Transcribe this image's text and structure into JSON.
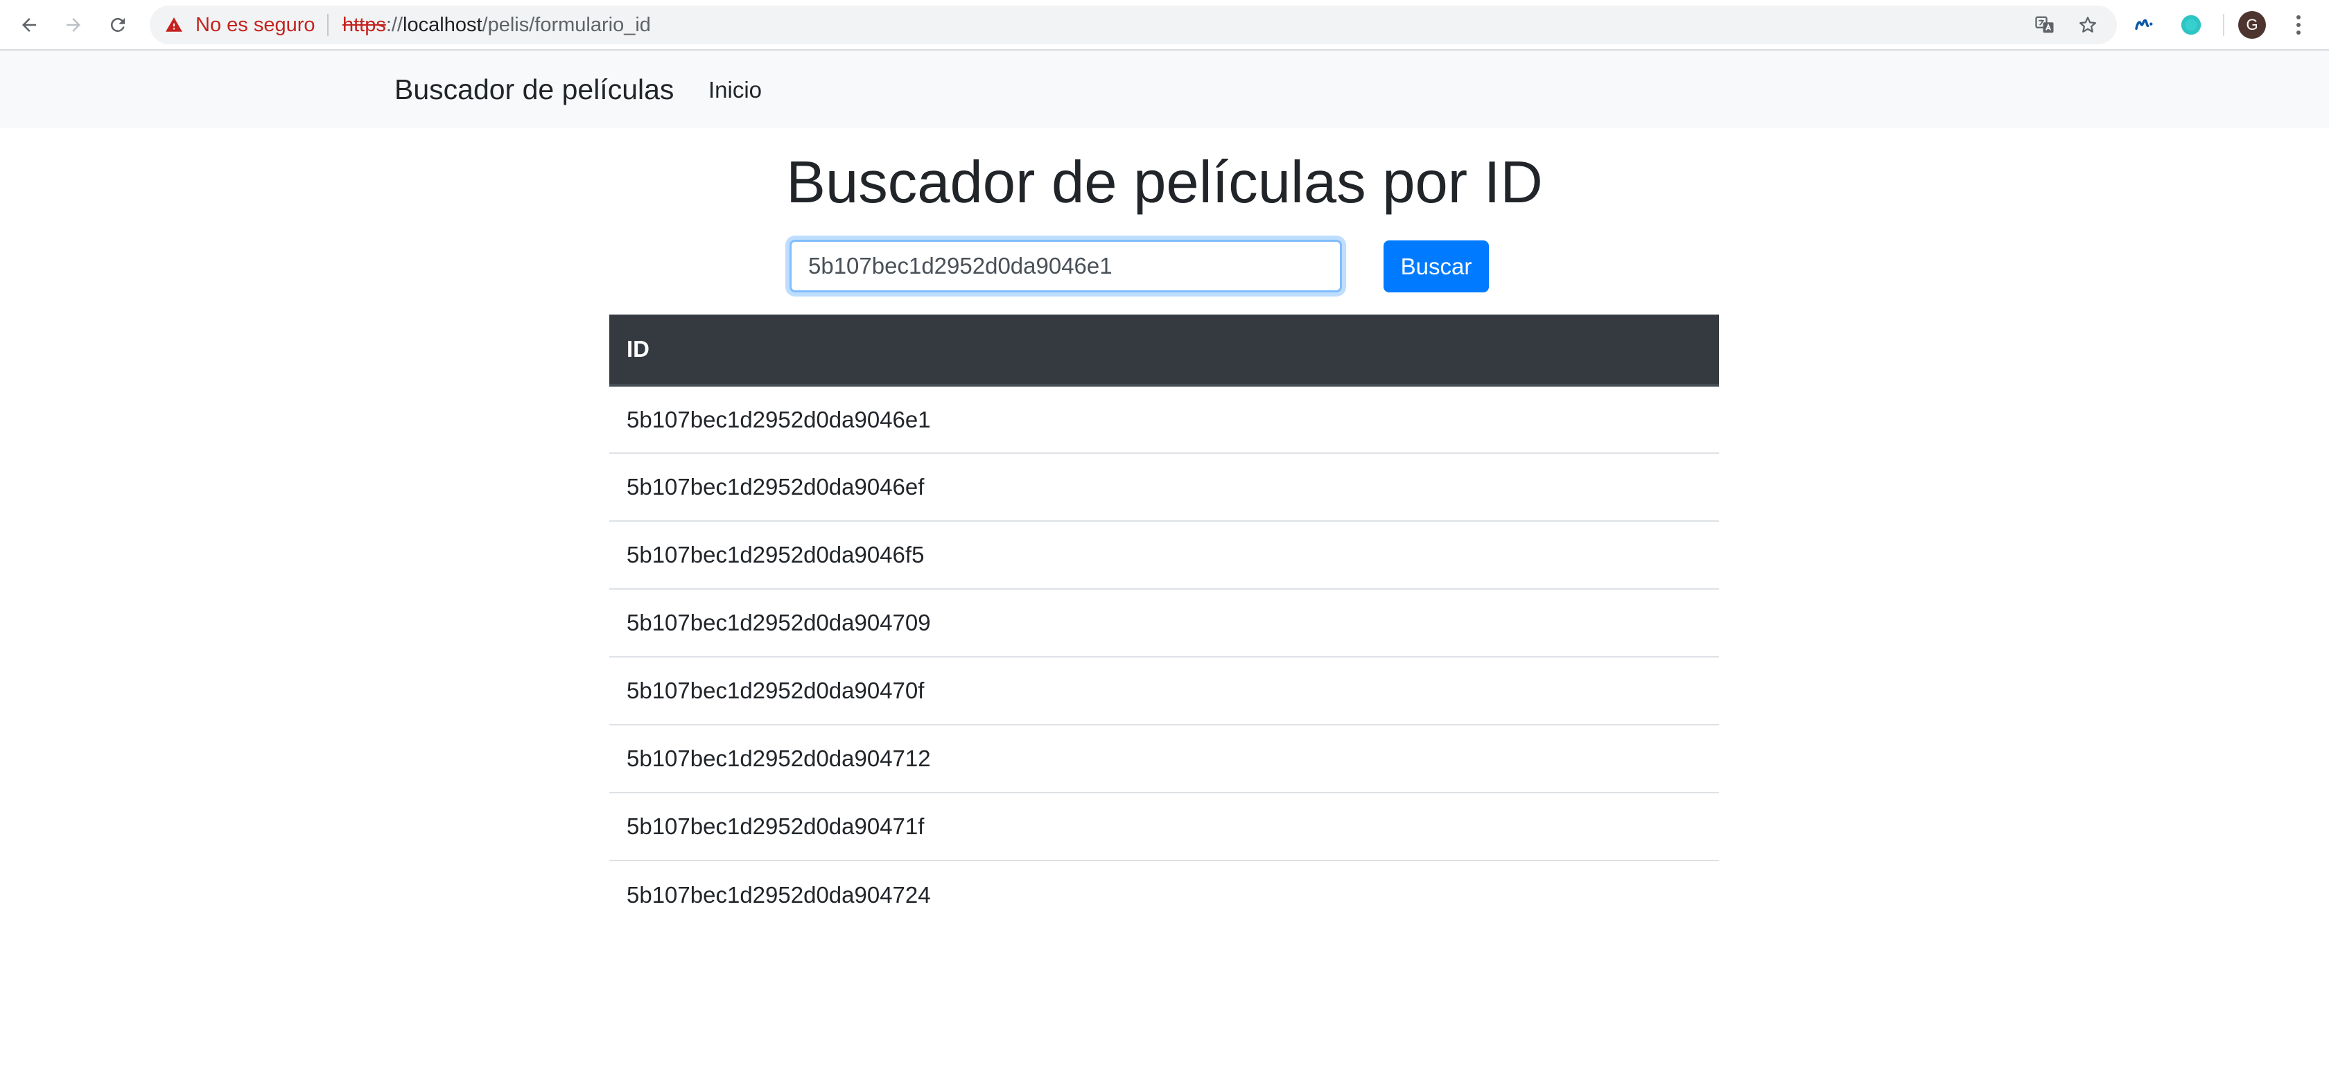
{
  "browser": {
    "security_label": "No es seguro",
    "url_scheme": "https",
    "url_sep": "://",
    "url_host": "localhost",
    "url_path": "/pelis/formulario_id",
    "avatar_letter": "G",
    "icons": [
      "back-icon",
      "forward-icon",
      "reload-icon",
      "warning-icon",
      "translate-icon",
      "star-icon",
      "movistar-extension-icon",
      "teal-extension-icon",
      "menu-dots-icon"
    ]
  },
  "navbar": {
    "brand": "Buscador de películas",
    "link_home": "Inicio"
  },
  "main": {
    "title": "Buscador de películas por ID",
    "search_value": "5b107bec1d2952d0da9046e1",
    "search_button": "Buscar"
  },
  "table": {
    "header": "ID",
    "rows": [
      "5b107bec1d2952d0da9046e1",
      "5b107bec1d2952d0da9046ef",
      "5b107bec1d2952d0da9046f5",
      "5b107bec1d2952d0da904709",
      "5b107bec1d2952d0da90470f",
      "5b107bec1d2952d0da904712",
      "5b107bec1d2952d0da90471f",
      "5b107bec1d2952d0da904724"
    ]
  },
  "colors": {
    "primary": "#007bff",
    "table_header": "#343a40",
    "navbar_bg": "#f8f9fa",
    "warning_red": "#c5221f",
    "extension_teal": "#2ec4c4"
  }
}
